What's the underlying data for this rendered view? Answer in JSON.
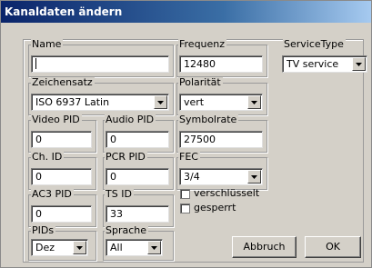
{
  "window": {
    "title": "Kanaldaten ändern"
  },
  "name": {
    "label": "Name",
    "value": ""
  },
  "frequenz": {
    "label": "Frequenz",
    "value": "12480"
  },
  "servicetype": {
    "label": "ServiceType",
    "value": "TV service"
  },
  "zeichensatz": {
    "label": "Zeichensatz",
    "value": "ISO 6937 Latin"
  },
  "polaritaet": {
    "label": "Polarität",
    "value": "vert"
  },
  "video_pid": {
    "label": "Video PID",
    "value": "0"
  },
  "audio_pid": {
    "label": "Audio PID",
    "value": "0"
  },
  "symbolrate": {
    "label": "Symbolrate",
    "value": "27500"
  },
  "ch_id": {
    "label": "Ch. ID",
    "value": "0"
  },
  "pcr_pid": {
    "label": "PCR PID",
    "value": "0"
  },
  "fec": {
    "label": "FEC",
    "value": "3/4"
  },
  "ac3_pid": {
    "label": "AC3 PID",
    "value": "0"
  },
  "ts_id": {
    "label": "TS ID",
    "value": "33"
  },
  "verschluesselt": {
    "label": "verschlüsselt",
    "checked": false
  },
  "gesperrt": {
    "label": "gesperrt",
    "checked": false
  },
  "pids": {
    "label": "PIDs",
    "value": "Dez"
  },
  "sprache": {
    "label": "Sprache",
    "value": "All"
  },
  "buttons": {
    "cancel": "Abbruch",
    "ok": "OK"
  }
}
